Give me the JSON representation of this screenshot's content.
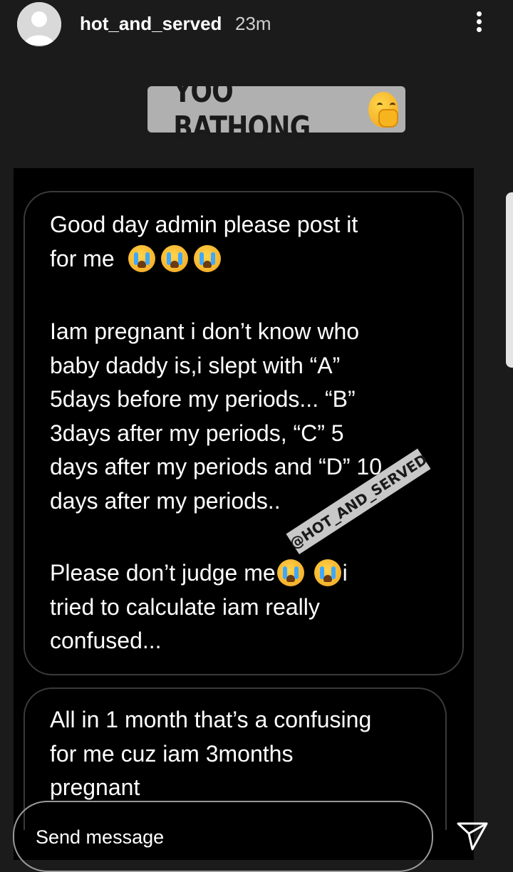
{
  "header": {
    "username": "hot_and_served",
    "time": "23m"
  },
  "sticker": {
    "text": "YOO BATHONG"
  },
  "messages": {
    "m1_line1": "Good day admin please post it",
    "m1_line2": "for me",
    "m2_line1": "Iam pregnant i don’t know who",
    "m2_line2": "baby daddy is,i slept with “A”",
    "m2_line3": "5days before my periods... “B”",
    "m2_line4": "3days after my periods, “C” 5",
    "m2_line5": "days after my periods and “D” 10",
    "m2_line6": "days after my periods..",
    "m3_line1a": "Please don’t judge me",
    "m3_line1b": "i",
    "m3_line2": "tried to calculate iam really",
    "m3_line3": "confused...",
    "m4_line1": "All in 1 month that’s a confusing",
    "m4_line2": "for me cuz iam 3months",
    "m4_line3": "pregnant"
  },
  "watermark": "@HOT_AND_SERVED",
  "reply": {
    "placeholder": "Send message"
  },
  "icons": {
    "more": "more-vertical-icon",
    "send": "send-icon",
    "avatar": "avatar-placeholder-icon"
  },
  "colors": {
    "background": "#1b1b1b",
    "sticker_bg": "#b0b0b0",
    "panel_bg": "#000000"
  }
}
